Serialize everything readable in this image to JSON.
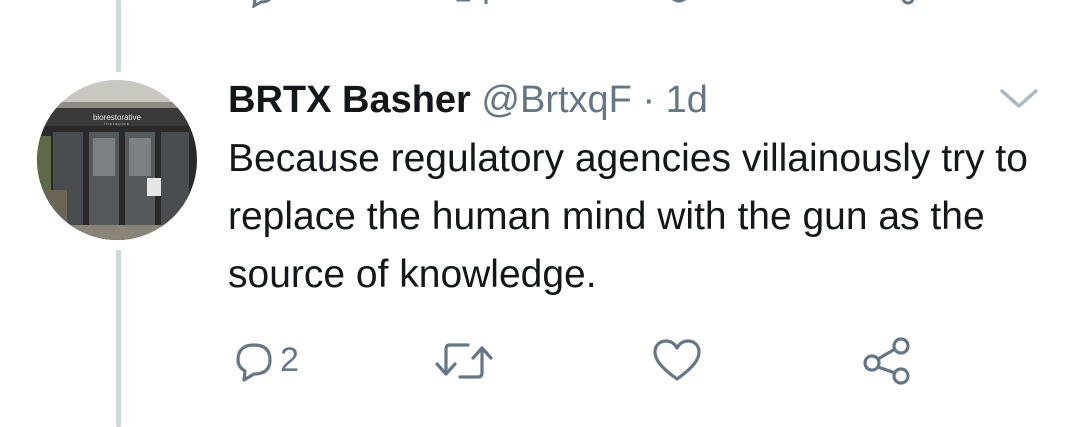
{
  "tweet": {
    "display_name": "BRTX Basher",
    "handle": "@BrtxqF",
    "separator": "·",
    "time": "1d",
    "text": "Because regulatory agencies villainously try to replace the human mind with the gun as the source of knowledge.",
    "reply_count": "2"
  },
  "avatar": {
    "sign_text": "biorestorative",
    "sign_subtext": "therapies"
  },
  "icons": {
    "reply": "speech-bubble-icon",
    "retweet": "retweet-arrows-icon",
    "like": "heart-icon",
    "share": "share-icon",
    "menu": "chevron-down-icon"
  },
  "colors": {
    "text_primary": "#14171a",
    "text_secondary": "#657786",
    "thread_line": "#ccd6dd"
  }
}
